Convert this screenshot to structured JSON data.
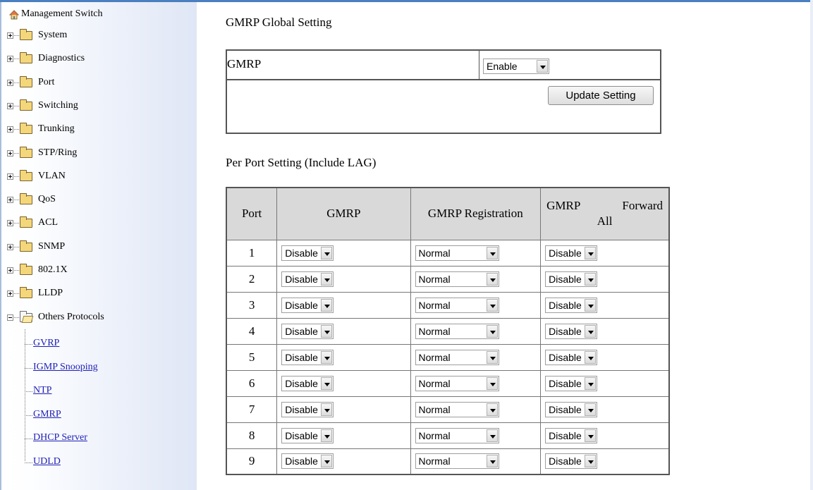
{
  "sidebar": {
    "root_label": "Management Switch",
    "folders": [
      {
        "label": "System"
      },
      {
        "label": "Diagnostics"
      },
      {
        "label": "Port"
      },
      {
        "label": "Switching"
      },
      {
        "label": "Trunking"
      },
      {
        "label": "STP/Ring"
      },
      {
        "label": "VLAN"
      },
      {
        "label": "QoS"
      },
      {
        "label": "ACL"
      },
      {
        "label": "SNMP"
      },
      {
        "label": "802.1X"
      },
      {
        "label": "LLDP"
      }
    ],
    "open_folder": {
      "label": "Others Protocols"
    },
    "links": [
      {
        "label": "GVRP"
      },
      {
        "label": "IGMP Snooping"
      },
      {
        "label": "NTP"
      },
      {
        "label": "GMRP"
      },
      {
        "label": "DHCP Server"
      },
      {
        "label": "UDLD"
      }
    ]
  },
  "global": {
    "title": "GMRP Global Setting",
    "gmrp_label": "GMRP",
    "gmrp_value": "Enable",
    "update_button": "Update Setting"
  },
  "per_port": {
    "title": "Per Port Setting (Include LAG)",
    "headers": {
      "port": "Port",
      "gmrp": "GMRP",
      "registration": "GMRP Registration",
      "forward_all_1": "GMRP Forward",
      "forward_all_2": "All"
    },
    "rows": [
      {
        "port": "1",
        "gmrp": "Disable",
        "registration": "Normal",
        "forward_all": "Disable"
      },
      {
        "port": "2",
        "gmrp": "Disable",
        "registration": "Normal",
        "forward_all": "Disable"
      },
      {
        "port": "3",
        "gmrp": "Disable",
        "registration": "Normal",
        "forward_all": "Disable"
      },
      {
        "port": "4",
        "gmrp": "Disable",
        "registration": "Normal",
        "forward_all": "Disable"
      },
      {
        "port": "5",
        "gmrp": "Disable",
        "registration": "Normal",
        "forward_all": "Disable"
      },
      {
        "port": "6",
        "gmrp": "Disable",
        "registration": "Normal",
        "forward_all": "Disable"
      },
      {
        "port": "7",
        "gmrp": "Disable",
        "registration": "Normal",
        "forward_all": "Disable"
      },
      {
        "port": "8",
        "gmrp": "Disable",
        "registration": "Normal",
        "forward_all": "Disable"
      },
      {
        "port": "9",
        "gmrp": "Disable",
        "registration": "Normal",
        "forward_all": "Disable"
      }
    ]
  },
  "colors": {
    "header_bg": "#d9d9d9",
    "link": "#1e1fb5",
    "frame_accent": "#4a7fc0"
  }
}
